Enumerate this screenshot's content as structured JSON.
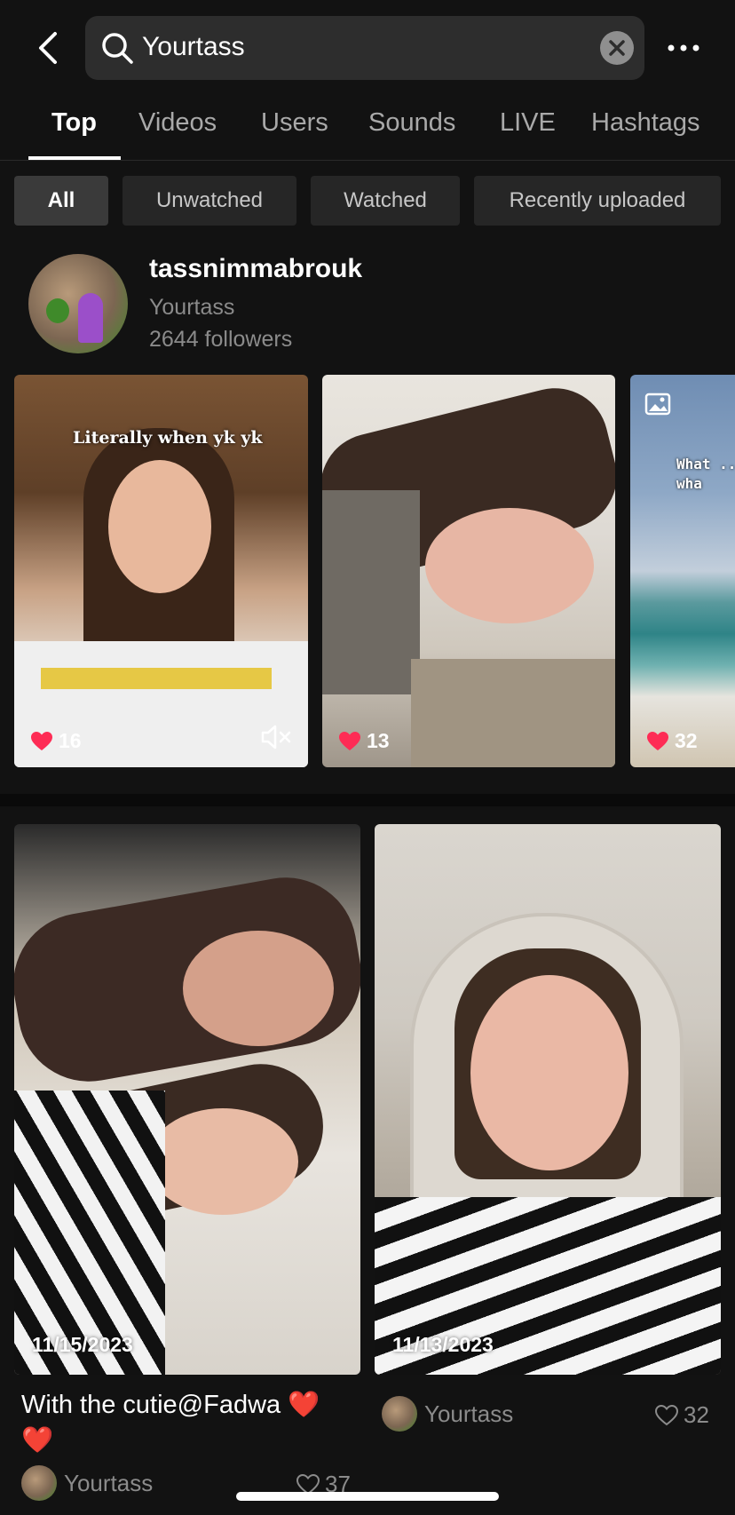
{
  "search": {
    "query": "Yourtass"
  },
  "tabs": [
    {
      "label": "Top"
    },
    {
      "label": "Videos"
    },
    {
      "label": "Users"
    },
    {
      "label": "Sounds"
    },
    {
      "label": "LIVE"
    },
    {
      "label": "Hashtags"
    }
  ],
  "filters": [
    {
      "label": "All"
    },
    {
      "label": "Unwatched"
    },
    {
      "label": "Watched"
    },
    {
      "label": "Recently uploaded"
    }
  ],
  "user": {
    "username": "tassnimmabrouk",
    "nickname": "Yourtass",
    "followers": "2644 followers"
  },
  "thumbnails": [
    {
      "likes": "16",
      "overlay_text": "Literally when yk yk",
      "muted_icon": "speaker-muted-icon"
    },
    {
      "likes": "13"
    },
    {
      "likes": "32",
      "overlay_text": "What ...\nwha",
      "type_icon": "image-icon"
    }
  ],
  "videos": [
    {
      "date": "11/15/2023",
      "caption": "With the cutie@Fadwa ❤️ ❤️",
      "author": "Yourtass",
      "likes": "37"
    },
    {
      "date": "11/13/2023",
      "author": "Yourtass",
      "likes": "32"
    }
  ],
  "colors": {
    "background": "#121212",
    "like_heart": "#fe2c55"
  }
}
